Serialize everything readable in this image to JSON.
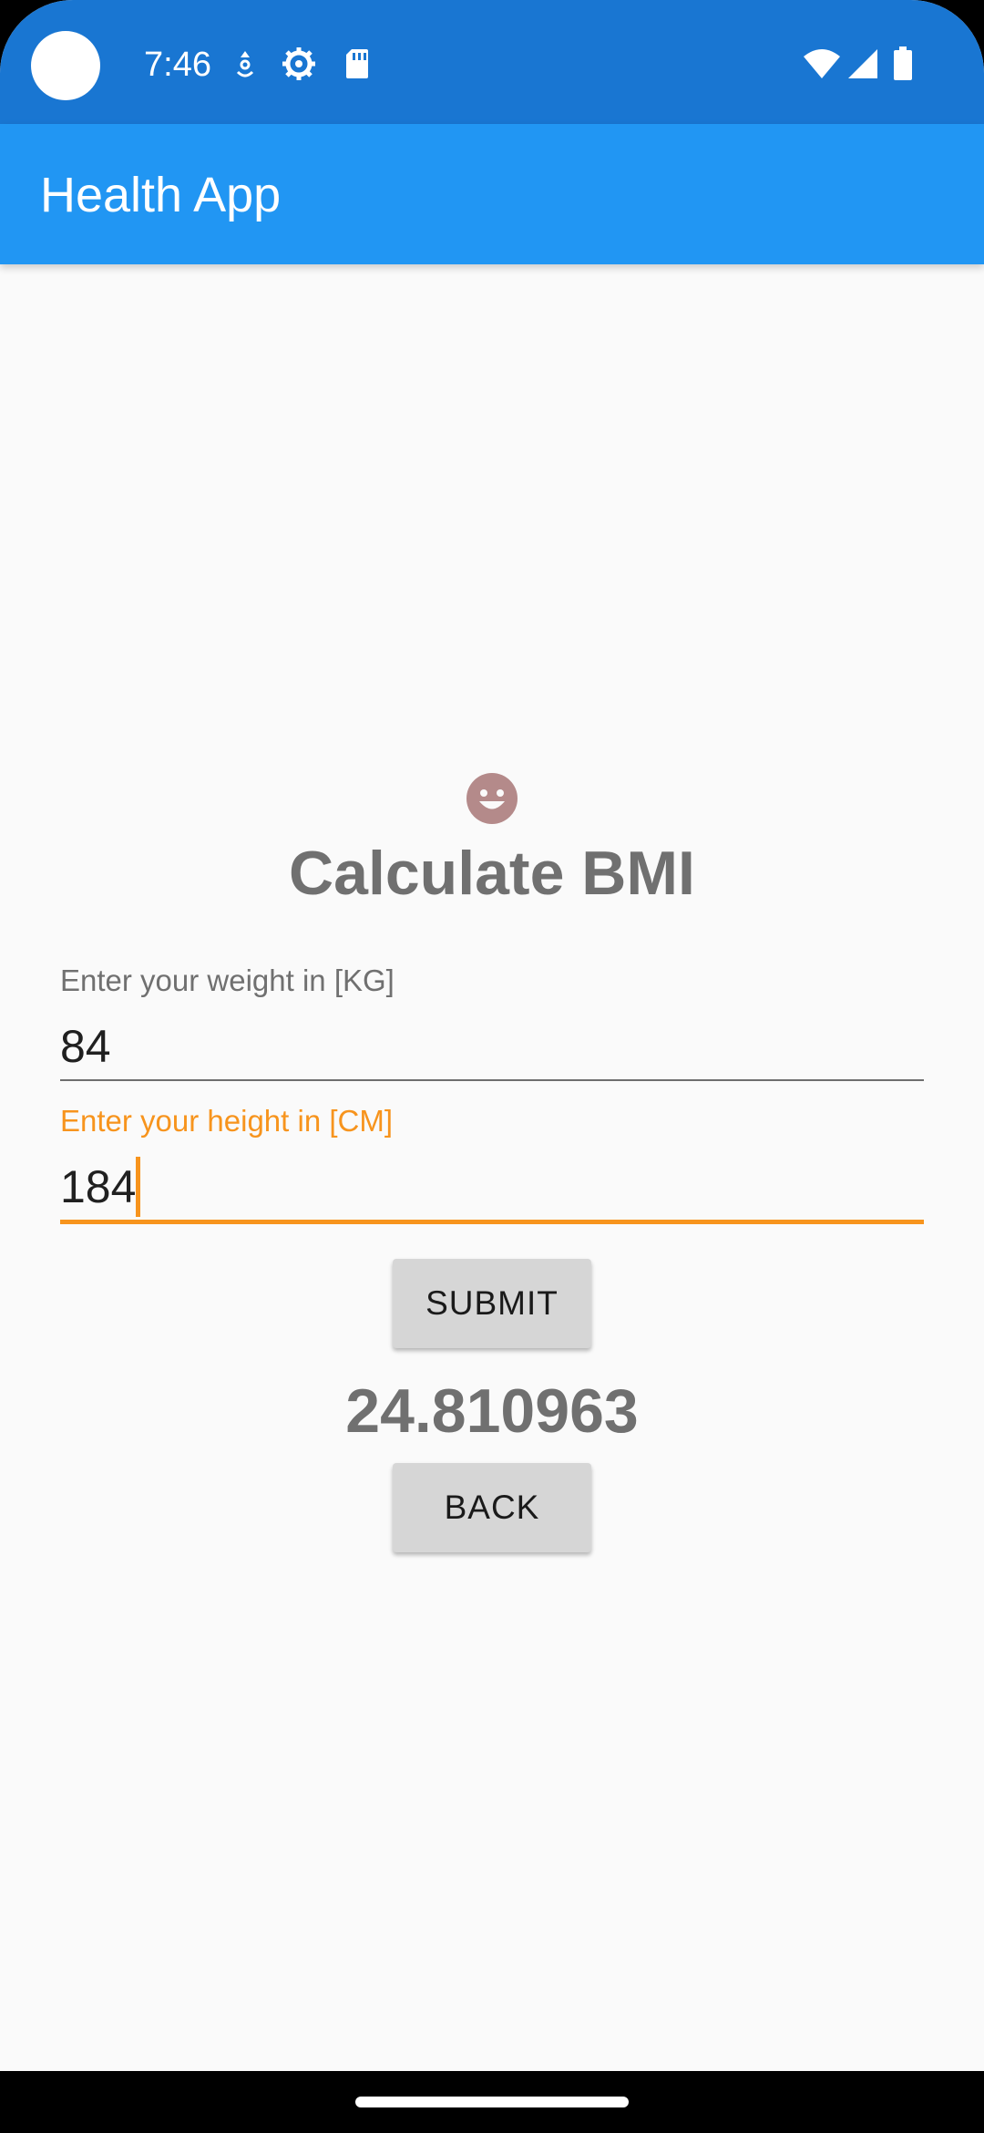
{
  "status_bar": {
    "time": "7:46",
    "icons": [
      "camera-dot",
      "notification-icon",
      "settings-icon",
      "sd-card-icon",
      "wifi-icon",
      "signal-icon",
      "battery-icon"
    ],
    "color": "#1976d2"
  },
  "app_bar": {
    "title": "Health App",
    "color": "#2196f3"
  },
  "main": {
    "icon": "smiley-icon",
    "heading": "Calculate BMI",
    "weight_field": {
      "label": "Enter your weight in [KG]",
      "value": "84"
    },
    "height_field": {
      "label": "Enter your height in [CM]",
      "value": "184",
      "focused": true
    },
    "submit_label": "SUBMIT",
    "result": "24.810963",
    "back_label": "BACK"
  },
  "colors": {
    "accent": "#f7941d",
    "heading_gray": "#707070",
    "button_gray": "#d6d6d6"
  }
}
